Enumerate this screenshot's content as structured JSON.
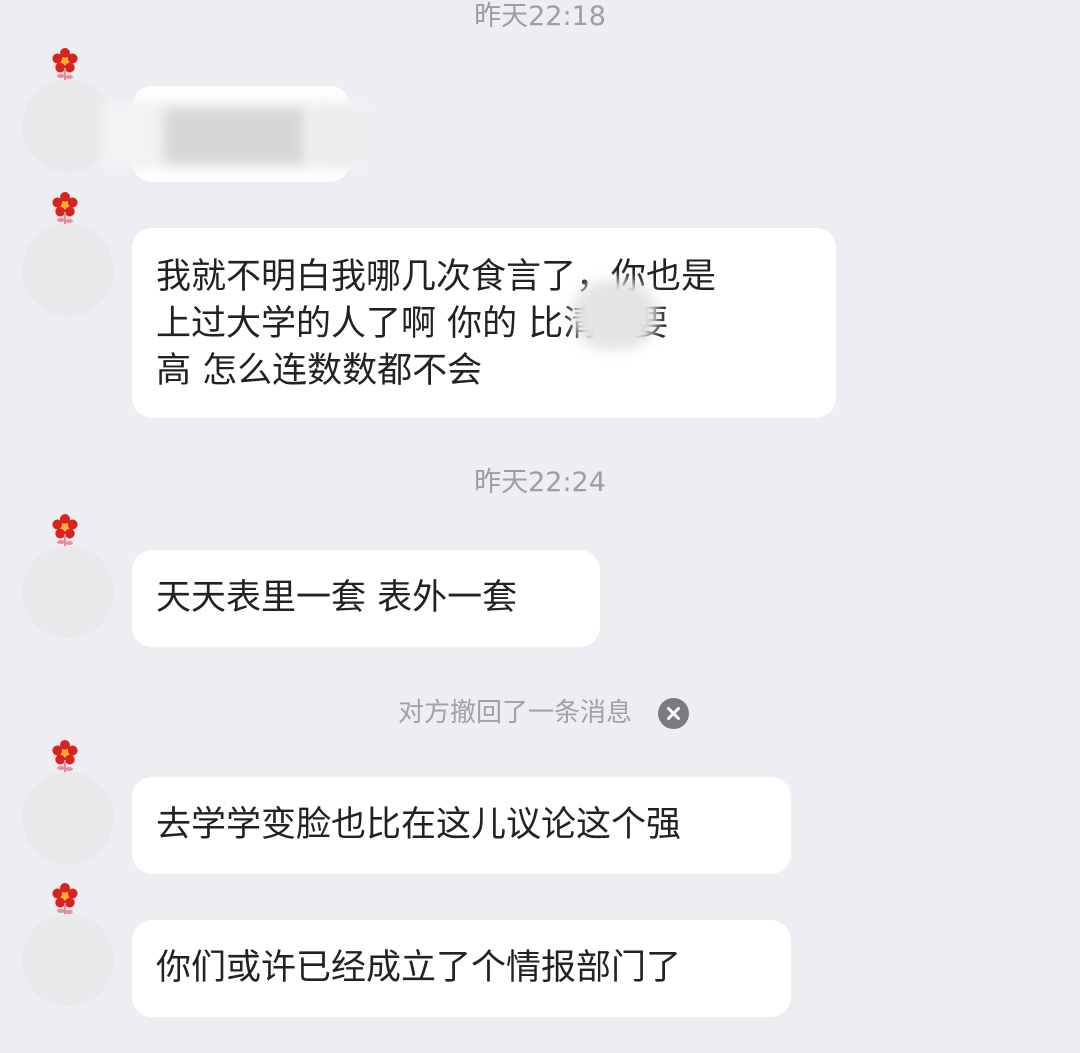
{
  "chat": {
    "timestamps": [
      "昨天22:18",
      "昨天22:24"
    ],
    "messages": [
      {
        "sender": "other",
        "text": "",
        "redacted": true
      },
      {
        "sender": "other",
        "lines": [
          "我就不明白我哪几次食言了，你也是",
          "上过大学的人了啊 你的    比清风要",
          "高 怎么连数数都不会"
        ]
      },
      {
        "sender": "other",
        "text": "天天表里一套 表外一套"
      },
      {
        "sender": "other",
        "text": "去学学变脸也比在这儿议论这个强"
      },
      {
        "sender": "other",
        "text": "你们或许已经成立了个情报部门了"
      }
    ],
    "recall_notice": "对方撤回了一条消息"
  },
  "icons": {
    "avatar_badge": "red-flower-icon",
    "recall_close": "close-circle-icon"
  },
  "colors": {
    "background": "#ededf2",
    "bubble": "#ffffff",
    "text": "#222222",
    "meta_text": "#9d9da2",
    "flower": "#d9231e"
  }
}
